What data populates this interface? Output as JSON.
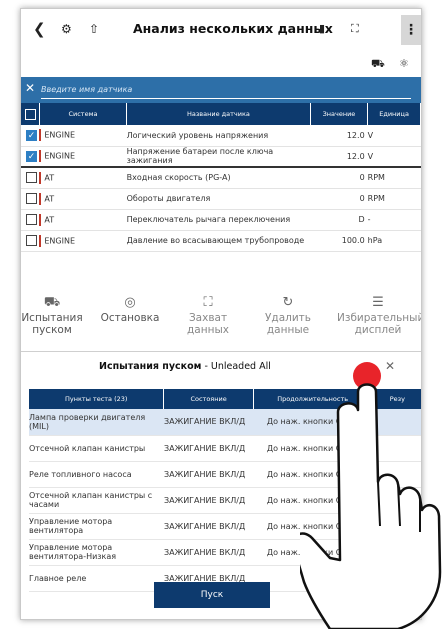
{
  "header": {
    "title": "Анализ нескольких данных"
  },
  "search": {
    "placeholder": "Введите имя датчика"
  },
  "data_table": {
    "columns": [
      "Система",
      "Название датчика",
      "Значение",
      "Единица"
    ],
    "rows": [
      {
        "system": "ENGINE",
        "name": "Логический уровень напряжения",
        "value": "12.0",
        "unit": "V",
        "checked": true
      },
      {
        "system": "ENGINE",
        "name": "Напряжение батареи после ключа зажигания",
        "value": "12.0",
        "unit": "V",
        "checked": true
      },
      {
        "system": "AT",
        "name": "Входная скорость (PG-A)",
        "value": "0",
        "unit": "RPM",
        "checked": false
      },
      {
        "system": "AT",
        "name": "Обороты двигателя",
        "value": "0",
        "unit": "RPM",
        "checked": false
      },
      {
        "system": "AT",
        "name": "Переключатель рычага переключения",
        "value": "D",
        "unit": "-",
        "checked": false
      },
      {
        "system": "ENGINE",
        "name": "Давление во всасывающем трубопроводе",
        "value": "100.0",
        "unit": "hPa",
        "checked": false
      }
    ]
  },
  "toolbar": {
    "items": [
      {
        "label": "Испытания пуском",
        "icon": "car-test-icon"
      },
      {
        "label": "Остановка",
        "icon": "stop-icon"
      },
      {
        "label": "Захват данных",
        "icon": "capture-icon"
      },
      {
        "label": "Удалить данные",
        "icon": "refresh-icon"
      },
      {
        "label": "Избирательный дисплей",
        "icon": "list-icon"
      }
    ]
  },
  "test_panel": {
    "title_bold": "Испытания пуском",
    "title_rest": " - Unleaded All",
    "columns": [
      "Пункты теста (23)",
      "Состояние",
      "Продолжительность",
      "Резу"
    ],
    "rows": [
      {
        "item": "Лампа проверки двигателя (MIL)",
        "state": "ЗАЖИГАНИЕ ВКЛ/Д",
        "duration": "До наж. кнопки СТОП"
      },
      {
        "item": "Отсечной клапан канистры",
        "state": "ЗАЖИГАНИЕ ВКЛ/Д",
        "duration": "До наж. кнопки СТОП"
      },
      {
        "item": "Реле топливного насоса",
        "state": "ЗАЖИГАНИЕ ВКЛ/Д",
        "duration": "До наж. кнопки СТОП"
      },
      {
        "item": "Отсечной клапан канистры с часами",
        "state": "ЗАЖИГАНИЕ ВКЛ/Д",
        "duration": "До наж. кнопки СТОП"
      },
      {
        "item": "Управление мотора вентилятора",
        "state": "ЗАЖИГАНИЕ ВКЛ/Д",
        "duration": "До наж. кнопки СТОП"
      },
      {
        "item": "Управление мотора вентилятора-Низкая",
        "state": "ЗАЖИГАНИЕ ВКЛ/Д",
        "duration": "До наж. кнопки СТОП"
      },
      {
        "item": "Главное реле",
        "state": "ЗАЖИГАНИЕ ВКЛ/Д",
        "duration": ""
      }
    ],
    "run_label": "Пуск",
    "more": "..."
  }
}
